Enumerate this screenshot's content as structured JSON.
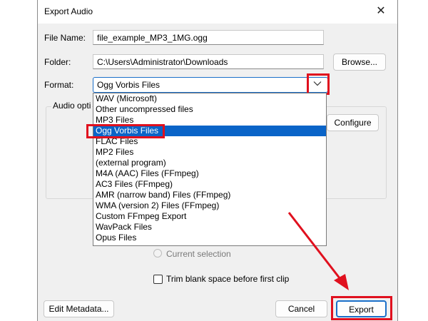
{
  "window": {
    "title": "Export Audio",
    "close_glyph": "✕"
  },
  "fields": {
    "file_name_label": "File Name:",
    "file_name_value": "file_example_MP3_1MG.ogg",
    "folder_label": "Folder:",
    "folder_value": "C:\\Users\\Administrator\\Downloads",
    "browse_label": "Browse...",
    "format_label": "Format:",
    "format_value": "Ogg Vorbis Files"
  },
  "format_options": [
    "WAV (Microsoft)",
    "Other uncompressed files",
    "MP3 Files",
    "Ogg Vorbis Files",
    "FLAC Files",
    "MP2 Files",
    "(external program)",
    "M4A (AAC) Files (FFmpeg)",
    "AC3 Files (FFmpeg)",
    "AMR (narrow band) Files (FFmpeg)",
    "WMA (version 2) Files (FFmpeg)",
    "Custom FFmpeg Export",
    "WavPack Files",
    "Opus Files"
  ],
  "selected_option_index": 3,
  "audio_options": {
    "group_title": "Audio opti",
    "configure_label": "Configure"
  },
  "export_range": {
    "current_selection_label": "Current selection"
  },
  "trim": {
    "label": "Trim blank space before first clip",
    "checked": false
  },
  "buttons": {
    "edit_metadata": "Edit Metadata...",
    "cancel": "Cancel",
    "export": "Export"
  },
  "icons": {
    "dropdown": "chevron-down-icon",
    "close": "close-icon"
  },
  "colors": {
    "highlight": "#e0101e",
    "selection": "#0a64c8",
    "accent": "#1a6fc9"
  }
}
